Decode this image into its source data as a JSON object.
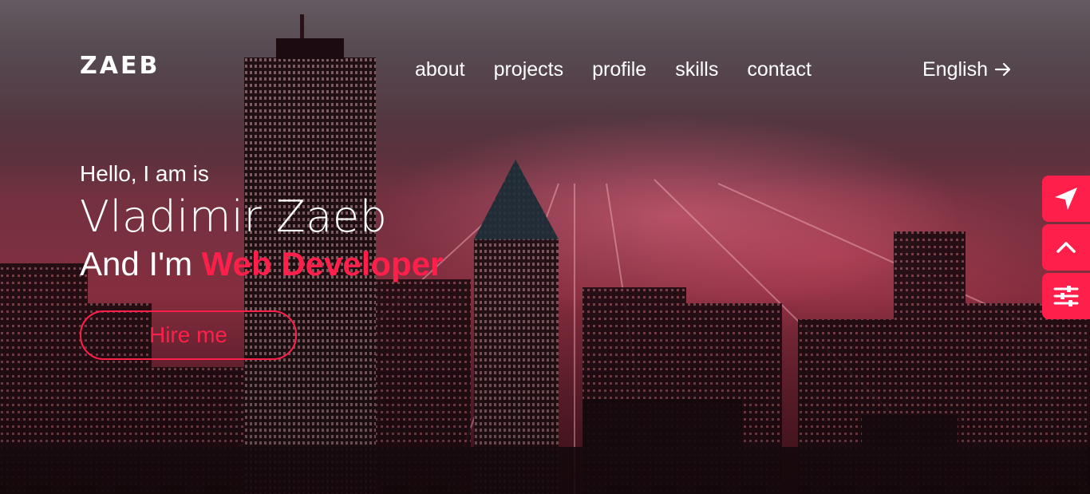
{
  "brand": {
    "logo_text": "ZAEB",
    "accent_color": "#ff1f4b"
  },
  "nav": {
    "items": [
      {
        "label": "about"
      },
      {
        "label": "projects"
      },
      {
        "label": "profile"
      },
      {
        "label": "skills"
      },
      {
        "label": "contact"
      }
    ],
    "language": {
      "label": "English",
      "icon": "arrow-right-icon"
    }
  },
  "hero": {
    "greeting": "Hello, I am is",
    "name": "Vladimir Zaeb",
    "role_prefix": "And I'm",
    "role_highlight": "Web Developer",
    "hire_button": "Hire me",
    "background": "night city skyline"
  },
  "side_buttons": [
    {
      "icon": "navigation-arrow-icon"
    },
    {
      "icon": "chevron-up-icon"
    },
    {
      "icon": "sliders-icon"
    }
  ]
}
